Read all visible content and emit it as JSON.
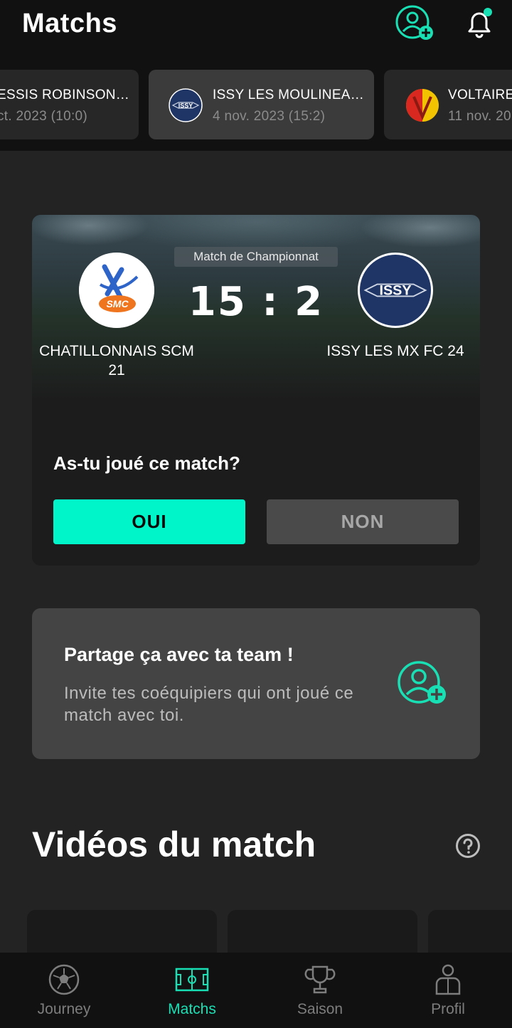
{
  "header": {
    "title": "Matchs"
  },
  "match_carousel": [
    {
      "name": "ESSIS ROBINSON…",
      "date": "ct. 2023 (10:0)",
      "active": false
    },
    {
      "name": "ISSY LES MOULINEA…",
      "date": "4 nov. 2023 (15:2)",
      "active": true,
      "logo_text": "ISSY"
    },
    {
      "name": "VOLTAIRE",
      "date": "11 nov. 20",
      "active": false
    }
  ],
  "match": {
    "competition": "Match de Championnat",
    "score": "15 : 2",
    "home_team": "CHATILLONNAIS SCM 21",
    "away_team": "ISSY LES MX FC 24",
    "away_logo_text": "ISSY",
    "question": "As-tu joué ce match?",
    "yes_label": "OUI",
    "no_label": "NON"
  },
  "share": {
    "title": "Partage ça avec ta team !",
    "description": "Invite tes coéquipiers qui ont joué ce match avec toi."
  },
  "videos": {
    "title": "Vidéos du match"
  },
  "bottom_nav": [
    {
      "label": "Journey",
      "icon": "soccer-ball-icon"
    },
    {
      "label": "Matchs",
      "icon": "pitch-icon",
      "active": true
    },
    {
      "label": "Saison",
      "icon": "trophy-icon"
    },
    {
      "label": "Profil",
      "icon": "player-icon"
    }
  ],
  "colors": {
    "accent": "#00f5c8",
    "background": "#232323",
    "header": "#111111"
  }
}
